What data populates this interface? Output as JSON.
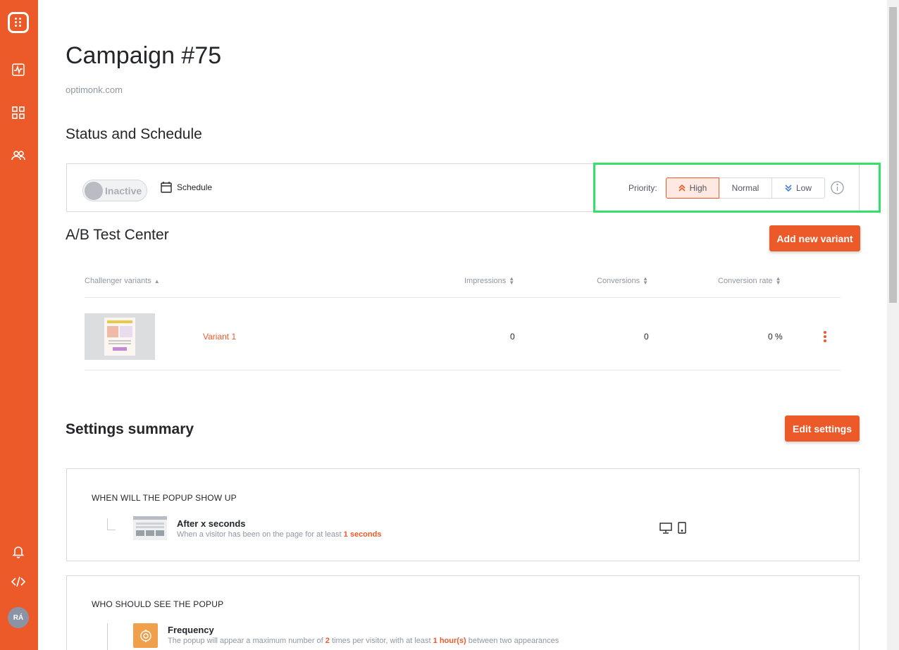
{
  "sidebar": {
    "logo": "optimonk-logo-icon",
    "items": [
      {
        "name": "dashboard-activity-icon"
      },
      {
        "name": "campaigns-grid-icon"
      },
      {
        "name": "users-icon"
      }
    ],
    "bottom": [
      {
        "name": "bell-icon"
      },
      {
        "name": "code-icon"
      }
    ],
    "avatar_initials": "RÁ",
    "brand_color": "#ed5a29"
  },
  "page": {
    "title": "Campaign #75",
    "domain": "optimonk.com"
  },
  "status": {
    "heading": "Status and Schedule",
    "toggle_label": "Inactive",
    "schedule_label": "Schedule",
    "priority_label": "Priority:",
    "priority_options": [
      "High",
      "Normal",
      "Low"
    ],
    "priority_selected": "High"
  },
  "ab_test": {
    "heading": "A/B Test Center",
    "add_button": "Add new variant",
    "columns": {
      "variants": "Challenger variants",
      "impressions": "Impressions",
      "conversions": "Conversions",
      "rate": "Conversion rate"
    },
    "rows": [
      {
        "name": "Variant 1",
        "impressions": "0",
        "conversions": "0",
        "rate": "0 %"
      }
    ]
  },
  "settings": {
    "heading": "Settings summary",
    "edit_button": "Edit settings",
    "when": {
      "title": "WHEN WILL THE POPUP SHOW UP",
      "rule_title": "After x seconds",
      "rule_desc_prefix": "When a visitor has been on the page for at least",
      "rule_desc_value": "1 seconds"
    },
    "who": {
      "title": "WHO SHOULD SEE THE POPUP",
      "rule_title": "Frequency",
      "desc_1": "The popup will appear a maximum number of",
      "desc_2": "2",
      "desc_3": "times per visitor, with at least",
      "desc_4": "1 hour(s)",
      "desc_5": "between two appearances"
    }
  }
}
